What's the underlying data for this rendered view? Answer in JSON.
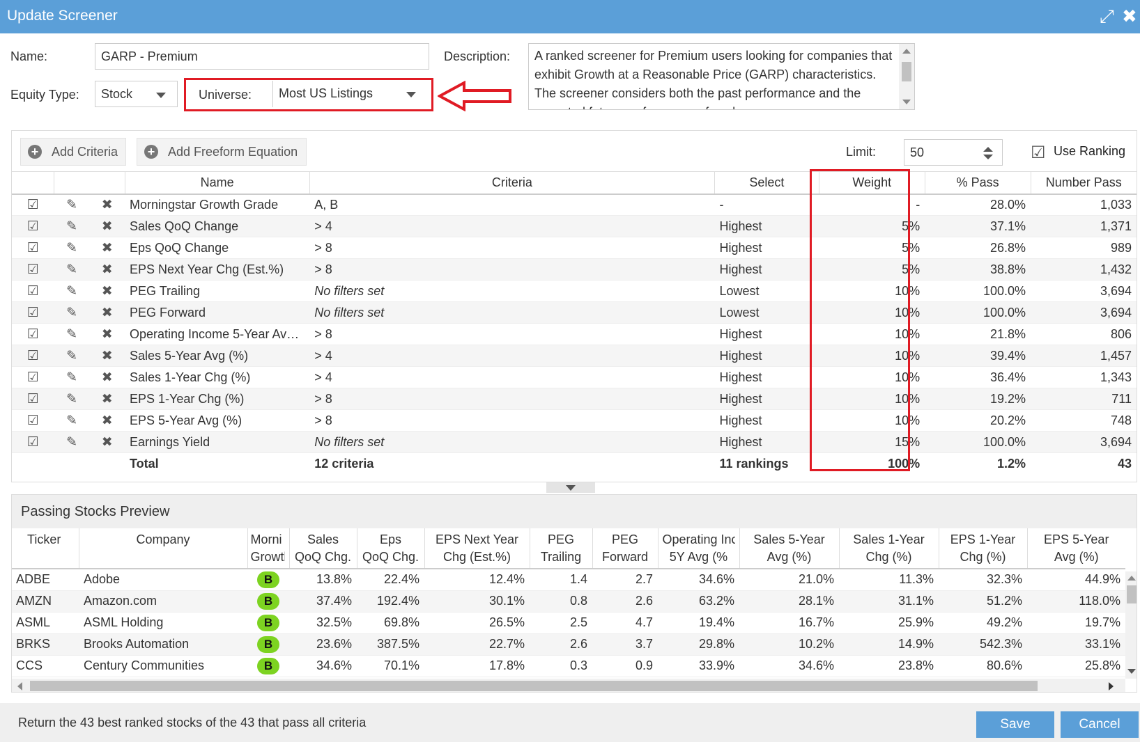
{
  "window": {
    "title": "Update Screener"
  },
  "form": {
    "name_label": "Name:",
    "name_value": "GARP - Premium",
    "description_label": "Description:",
    "description_value": "A ranked screener for Premium users looking for companies that exhibit Growth at a Reasonable Price (GARP) characteristics. The screener considers both the past performance and the expected future performance of each",
    "equity_type_label": "Equity Type:",
    "equity_type_value": "Stock",
    "universe_label": "Universe:",
    "universe_value": "Most US Listings"
  },
  "toolbar": {
    "add_criteria": "Add Criteria",
    "add_freeform": "Add Freeform Equation",
    "limit_label": "Limit:",
    "limit_value": "50",
    "use_ranking": "Use Ranking"
  },
  "criteria_table": {
    "headers": {
      "name": "Name",
      "criteria": "Criteria",
      "select": "Select",
      "weight": "Weight",
      "pass_pct": "% Pass",
      "number_pass": "Number Pass"
    },
    "rows": [
      {
        "name": "Morningstar Growth Grade",
        "criteria": "A, B",
        "select": "-",
        "weight": "-",
        "pass_pct": "28.0%",
        "number_pass": "1,033"
      },
      {
        "name": "Sales QoQ Change",
        "criteria": "> 4",
        "select": "Highest",
        "weight": "5%",
        "pass_pct": "37.1%",
        "number_pass": "1,371"
      },
      {
        "name": "Eps QoQ Change",
        "criteria": "> 8",
        "select": "Highest",
        "weight": "5%",
        "pass_pct": "26.8%",
        "number_pass": "989"
      },
      {
        "name": "EPS Next Year Chg (Est.%)",
        "criteria": "> 8",
        "select": "Highest",
        "weight": "5%",
        "pass_pct": "38.8%",
        "number_pass": "1,432"
      },
      {
        "name": "PEG Trailing",
        "criteria": "No filters set",
        "select": "Lowest",
        "weight": "10%",
        "pass_pct": "100.0%",
        "number_pass": "3,694"
      },
      {
        "name": "PEG Forward",
        "criteria": "No filters set",
        "select": "Lowest",
        "weight": "10%",
        "pass_pct": "100.0%",
        "number_pass": "3,694"
      },
      {
        "name": "Operating Income 5-Year Av…",
        "criteria": "> 8",
        "select": "Highest",
        "weight": "10%",
        "pass_pct": "21.8%",
        "number_pass": "806"
      },
      {
        "name": "Sales 5-Year Avg (%)",
        "criteria": "> 4",
        "select": "Highest",
        "weight": "10%",
        "pass_pct": "39.4%",
        "number_pass": "1,457"
      },
      {
        "name": "Sales 1-Year Chg (%)",
        "criteria": "> 4",
        "select": "Highest",
        "weight": "10%",
        "pass_pct": "36.4%",
        "number_pass": "1,343"
      },
      {
        "name": "EPS 1-Year Chg (%)",
        "criteria": "> 8",
        "select": "Highest",
        "weight": "10%",
        "pass_pct": "19.2%",
        "number_pass": "711"
      },
      {
        "name": "EPS 5-Year Avg (%)",
        "criteria": "> 8",
        "select": "Highest",
        "weight": "10%",
        "pass_pct": "20.2%",
        "number_pass": "748"
      },
      {
        "name": "Earnings Yield",
        "criteria": "No filters set",
        "select": "Highest",
        "weight": "15%",
        "pass_pct": "100.0%",
        "number_pass": "3,694"
      }
    ],
    "total": {
      "name": "Total",
      "criteria": "12 criteria",
      "select": "11 rankings",
      "weight": "100%",
      "pass_pct": "1.2%",
      "number_pass": "43"
    }
  },
  "preview": {
    "title": "Passing Stocks Preview",
    "headers": [
      [
        "Ticker",
        ""
      ],
      [
        "Company",
        ""
      ],
      [
        "Morni",
        "Growth"
      ],
      [
        "Sales",
        "QoQ Chg."
      ],
      [
        "Eps",
        "QoQ Chg."
      ],
      [
        "EPS Next Year",
        "Chg (Est.%)"
      ],
      [
        "PEG",
        "Trailing"
      ],
      [
        "PEG",
        "Forward"
      ],
      [
        "Operating Inc",
        "5Y Avg (%"
      ],
      [
        "Sales 5-Year",
        "Avg (%)"
      ],
      [
        "Sales 1-Year",
        "Chg (%)"
      ],
      [
        "EPS 1-Year",
        "Chg (%)"
      ],
      [
        "EPS 5-Year",
        "Avg (%)"
      ]
    ],
    "rows": [
      [
        "ADBE",
        "Adobe",
        "B",
        "13.8%",
        "22.4%",
        "12.4%",
        "1.4",
        "2.7",
        "34.6%",
        "21.0%",
        "11.3%",
        "32.3%",
        "44.9%"
      ],
      [
        "AMZN",
        "Amazon.com",
        "B",
        "37.4%",
        "192.4%",
        "30.1%",
        "0.8",
        "2.6",
        "63.2%",
        "28.1%",
        "31.1%",
        "51.2%",
        "118.0%"
      ],
      [
        "ASML",
        "ASML Holding",
        "B",
        "32.5%",
        "69.8%",
        "26.5%",
        "2.5",
        "4.7",
        "19.4%",
        "16.7%",
        "25.9%",
        "49.2%",
        "19.7%"
      ],
      [
        "BRKS",
        "Brooks Automation",
        "B",
        "23.6%",
        "387.5%",
        "22.7%",
        "2.6",
        "3.7",
        "29.8%",
        "10.2%",
        "14.9%",
        "542.3%",
        "33.1%"
      ],
      [
        "CCS",
        "Century Communities",
        "B",
        "34.6%",
        "70.1%",
        "17.8%",
        "0.3",
        "0.9",
        "33.9%",
        "34.6%",
        "23.8%",
        "80.6%",
        "25.8%"
      ]
    ]
  },
  "footer": {
    "message": "Return the 43 best ranked stocks of the 43 that pass all criteria",
    "save": "Save",
    "cancel": "Cancel"
  },
  "colors": {
    "accent": "#5b9fd8",
    "highlight": "#e01b24",
    "grade": "#7dd321"
  },
  "icons": [
    "expand-icon",
    "close-icon",
    "plus-circle-icon",
    "checkbox-icon",
    "edit-icon",
    "delete-icon",
    "spinner-icon",
    "arrow-left-icon"
  ]
}
